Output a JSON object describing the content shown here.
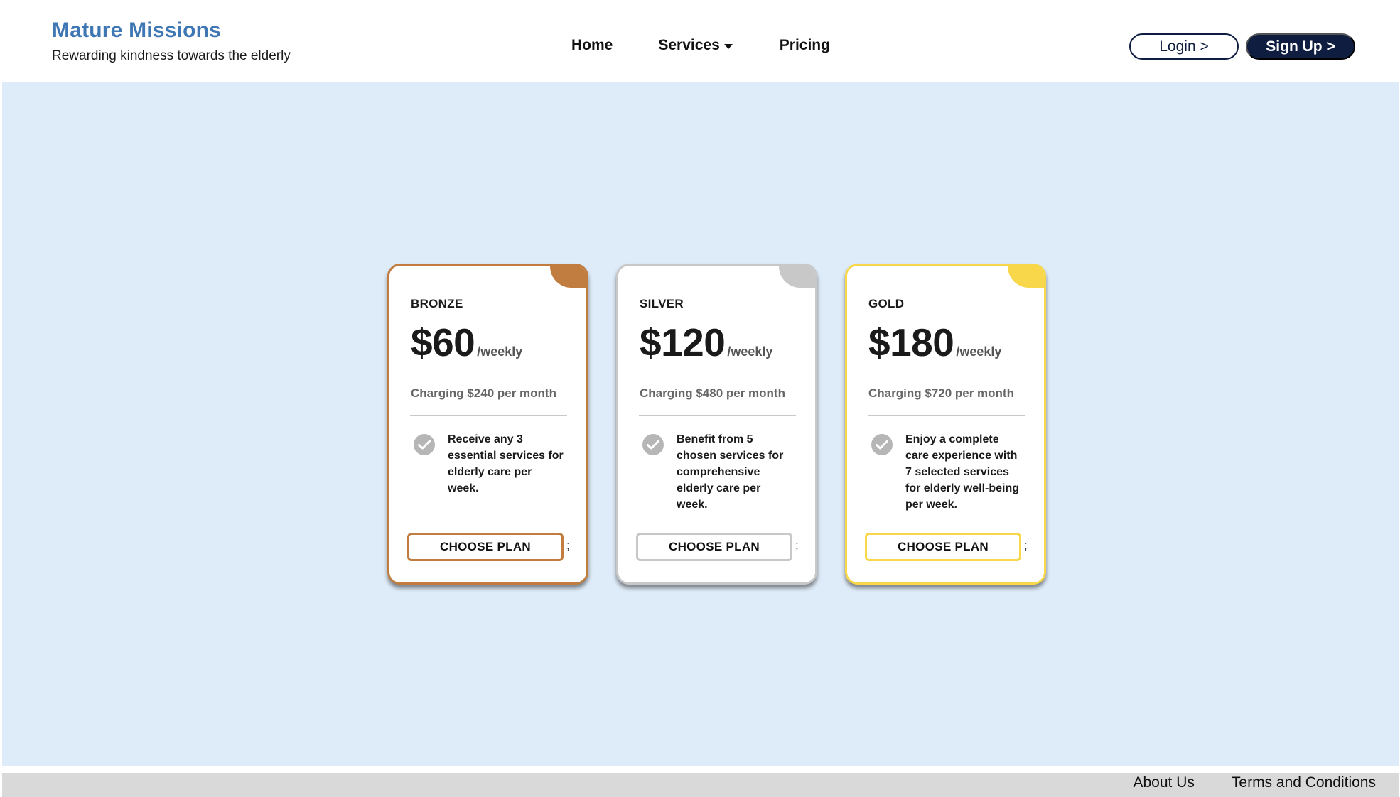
{
  "brand": {
    "title": "Mature Missions",
    "tagline": "Rewarding kindness towards the elderly",
    "color": "#3f76b4"
  },
  "nav": {
    "home": "Home",
    "services": "Services",
    "pricing": "Pricing"
  },
  "auth": {
    "login": "Login >",
    "signup": "Sign Up >"
  },
  "plans": [
    {
      "tier": "BRONZE",
      "price": "$60",
      "period": "/weekly",
      "monthly": "Charging $240 per month",
      "feature": "Receive any 3 essential services for elderly care per week.",
      "button": "CHOOSE PLAN",
      "trailing": ";",
      "accent": "#c07d3f"
    },
    {
      "tier": "SILVER",
      "price": "$120",
      "period": "/weekly",
      "monthly": "Charging $480 per month",
      "feature": "Benefit from 5 chosen services for comprehensive elderly care per week.",
      "button": "CHOOSE PLAN",
      "trailing": ";",
      "accent": "#c8c8c8"
    },
    {
      "tier": "GOLD",
      "price": "$180",
      "period": "/weekly",
      "monthly": "Charging $720 per month",
      "feature": "Enjoy a complete care experience with 7 selected services for elderly well-being per week.",
      "button": "CHOOSE PLAN",
      "trailing": ";",
      "accent": "#f8d84a"
    }
  ],
  "footer": {
    "about": "About Us",
    "terms": "Terms and Conditions"
  },
  "colors": {
    "navy": "#0f1d40",
    "main_background": "#deebf8",
    "footer_background": "#d9d9d9"
  },
  "icons": {
    "services_caret": "chevron-down-icon",
    "feature_check": "check-circle-icon"
  }
}
